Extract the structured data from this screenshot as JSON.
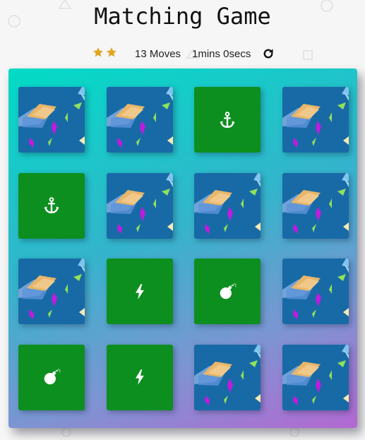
{
  "title": "Matching Game",
  "score_panel": {
    "stars": 2,
    "moves": "13 Moves",
    "timer": "1mins 0secs",
    "restart_icon": "restart-icon"
  },
  "colors": {
    "card_open": "#0c8f1e",
    "card_closed": "#186aa6",
    "star": "#e0a51f"
  },
  "deck": {
    "columns": 4,
    "cards": [
      {
        "state": "closed",
        "symbol": ""
      },
      {
        "state": "closed",
        "symbol": ""
      },
      {
        "state": "open",
        "symbol": "anchor"
      },
      {
        "state": "closed",
        "symbol": ""
      },
      {
        "state": "open",
        "symbol": "anchor"
      },
      {
        "state": "closed",
        "symbol": ""
      },
      {
        "state": "closed",
        "symbol": ""
      },
      {
        "state": "closed",
        "symbol": ""
      },
      {
        "state": "closed",
        "symbol": ""
      },
      {
        "state": "open",
        "symbol": "bolt"
      },
      {
        "state": "open",
        "symbol": "bomb"
      },
      {
        "state": "closed",
        "symbol": ""
      },
      {
        "state": "open",
        "symbol": "bomb"
      },
      {
        "state": "open",
        "symbol": "bolt"
      },
      {
        "state": "closed",
        "symbol": ""
      },
      {
        "state": "closed",
        "symbol": ""
      }
    ]
  }
}
